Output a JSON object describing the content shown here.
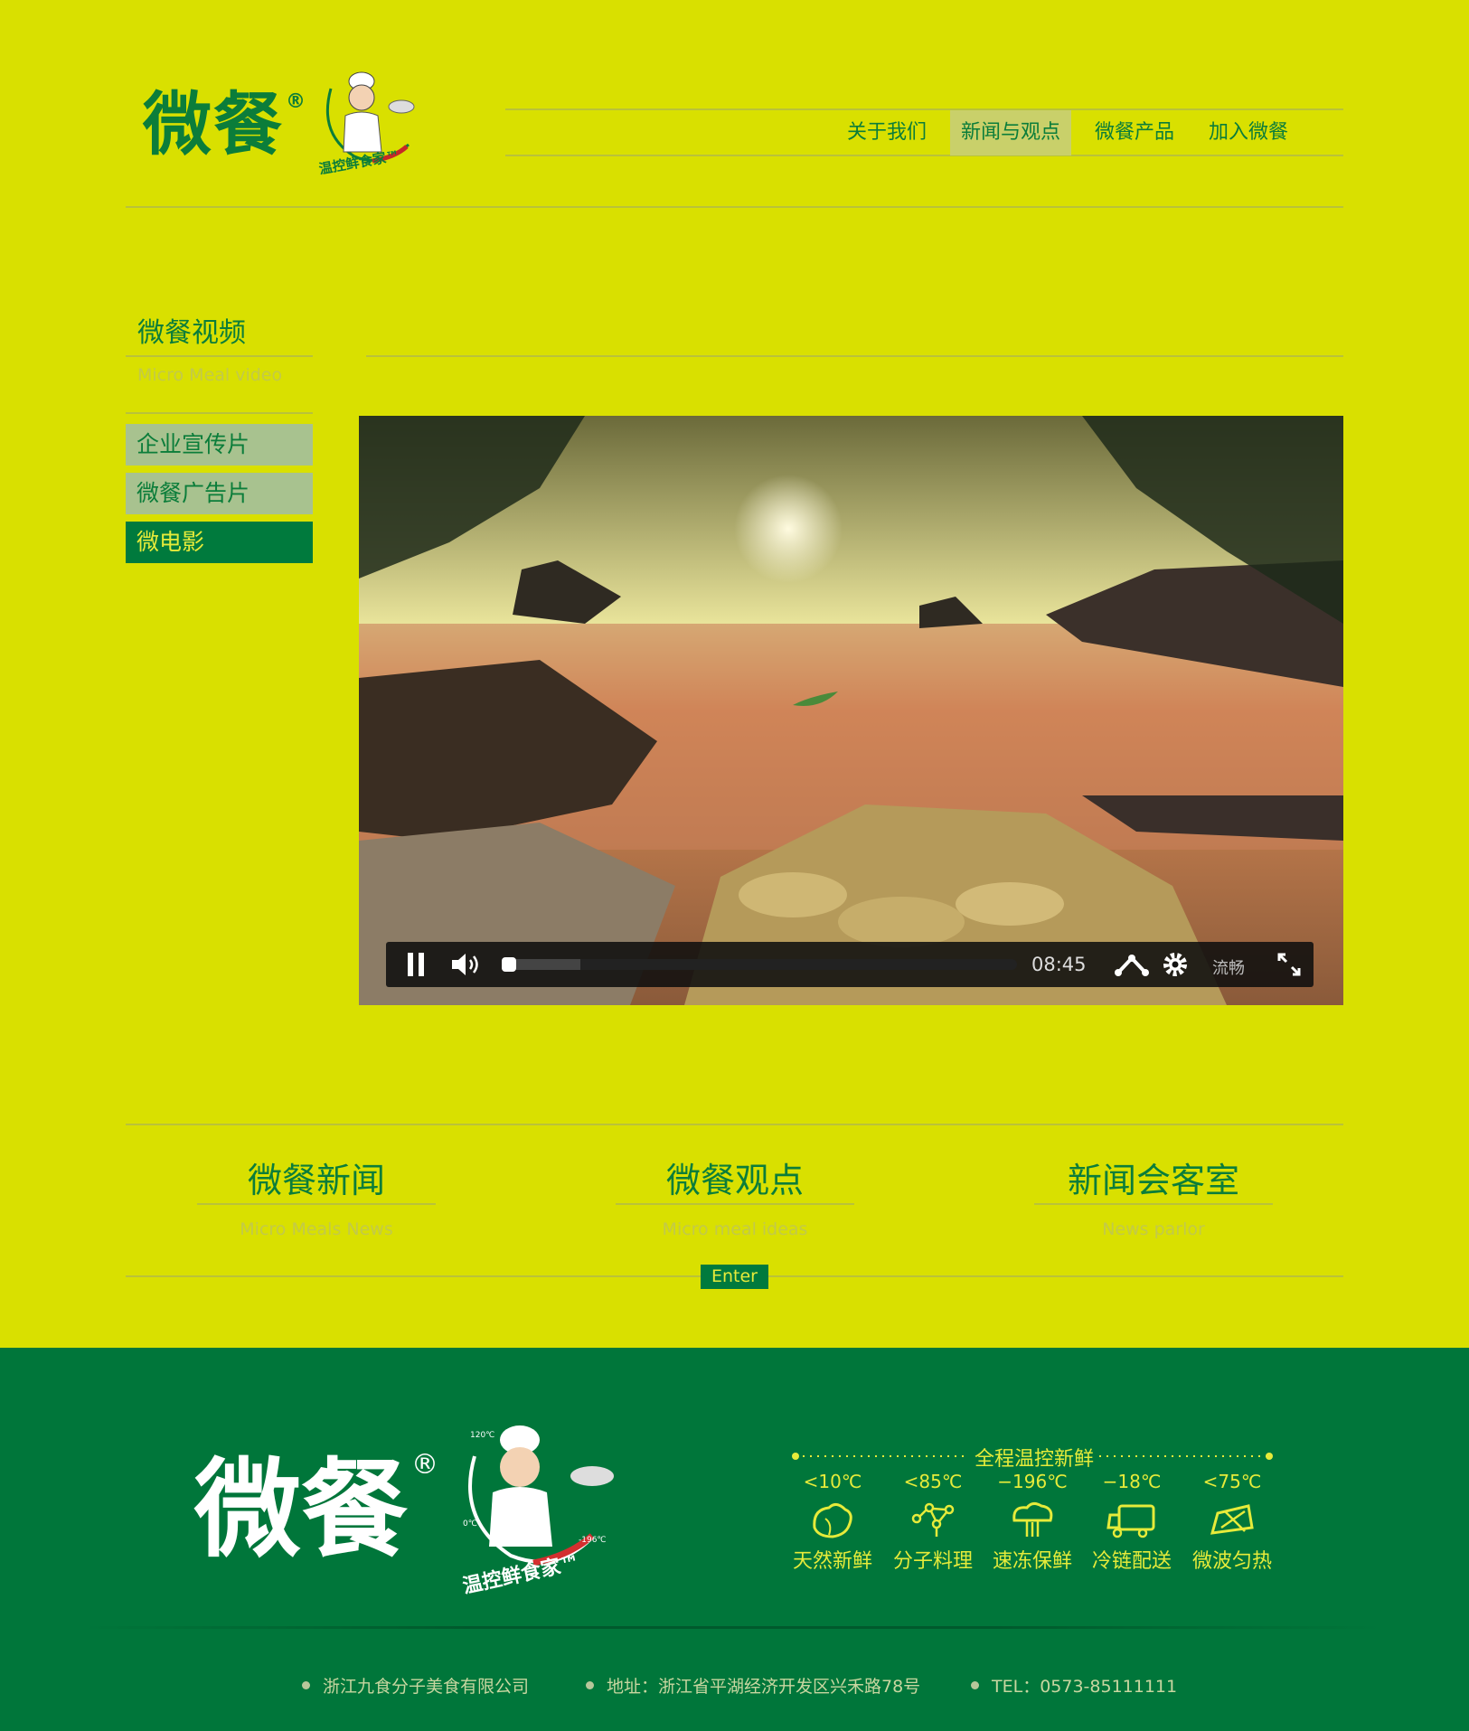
{
  "header": {
    "logo_text": "微餐",
    "logo_reg": "®",
    "chef_slogan": "温控鲜食家™",
    "nav": [
      {
        "label": "关于我们",
        "active": false
      },
      {
        "label": "新闻与观点",
        "active": true
      },
      {
        "label": "微餐产品",
        "active": false
      },
      {
        "label": "加入微餐",
        "active": false
      }
    ]
  },
  "section": {
    "title": "微餐视频",
    "subtitle": "Micro Meal video",
    "side_items": [
      {
        "label": "企业宣传片",
        "active": false
      },
      {
        "label": "微餐广告片",
        "active": false
      },
      {
        "label": "微电影",
        "active": true
      }
    ]
  },
  "video": {
    "time": "08:45",
    "quality": "流畅",
    "progress": 0.15
  },
  "news": [
    {
      "title": "微餐新闻",
      "subtitle": "Micro Meals News"
    },
    {
      "title": "微餐观点",
      "subtitle": "Micro meal ideas"
    },
    {
      "title": "新闻会客室",
      "subtitle": "News parlor"
    }
  ],
  "enter_label": "Enter",
  "footer": {
    "logo_text": "微餐",
    "logo_reg": "®",
    "chef_slogan": "温控鲜食家™",
    "chef_temps": [
      "120℃",
      "0℃",
      "-196℃"
    ],
    "slogan": "全程温控新鲜",
    "features": [
      {
        "temp": "<10℃",
        "name": "天然新鲜",
        "icon": "vegetable-icon"
      },
      {
        "temp": "<85℃",
        "name": "分子料理",
        "icon": "molecule-icon"
      },
      {
        "temp": "−196℃",
        "name": "速冻保鲜",
        "icon": "mushroom-icon"
      },
      {
        "temp": "−18℃",
        "name": "冷链配送",
        "icon": "truck-icon"
      },
      {
        "temp": "<75℃",
        "name": "微波匀热",
        "icon": "microwave-icon"
      }
    ],
    "company": "浙江九食分子美食有限公司",
    "address": "地址：浙江省平湖经济开发区兴禾路78号",
    "tel": "TEL：0573-85111111"
  },
  "colors": {
    "background": "#d9e000",
    "brand_green": "#007a3d",
    "accent_yellow": "#e6eb3a"
  }
}
